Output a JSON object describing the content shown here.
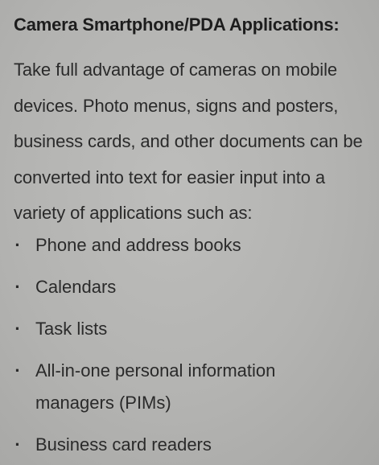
{
  "heading": "Camera Smartphone/PDA Applications:",
  "intro_lines": [
    "Take full advantage of cameras on mobile",
    "devices.  Photo menus, signs and posters,",
    "business cards, and other documents can be",
    "converted into text for easier input into a",
    "variety of applications such as:"
  ],
  "bullet_glyph": "·",
  "bullets": [
    {
      "lines": [
        "Phone and address books"
      ]
    },
    {
      "lines": [
        "Calendars"
      ]
    },
    {
      "lines": [
        "Task lists"
      ]
    },
    {
      "lines": [
        "All-in-one personal information",
        "managers (PIMs)"
      ]
    },
    {
      "lines": [
        "Business card readers"
      ]
    }
  ]
}
